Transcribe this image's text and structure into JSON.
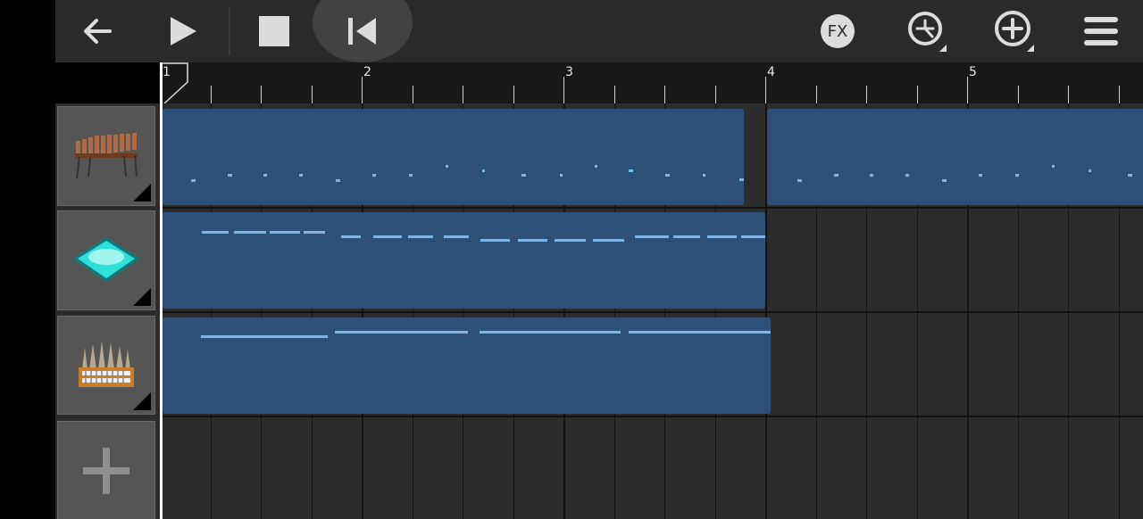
{
  "toolbar": {
    "back_icon": "arrow-left-icon",
    "play_icon": "play-icon",
    "stop_icon": "stop-icon",
    "rewind_icon": "skip-to-start-icon",
    "fx_label": "FX",
    "metronome_icon": "metronome-icon",
    "add_icon": "plus-circle-icon",
    "menu_icon": "hamburger-menu-icon"
  },
  "ruler": {
    "bar_labels": [
      "1",
      "2",
      "3",
      "4",
      "5"
    ]
  },
  "tracks": [
    {
      "name": "marimba",
      "icon": "marimba-icon"
    },
    {
      "name": "synth-pad",
      "icon": "synth-pad-icon"
    },
    {
      "name": "organ",
      "icon": "organ-icon"
    }
  ],
  "add_track_icon": "plus-icon",
  "colors": {
    "clip": "#2e5078",
    "note": "#7fb6ea",
    "background": "#2a2a2a"
  }
}
